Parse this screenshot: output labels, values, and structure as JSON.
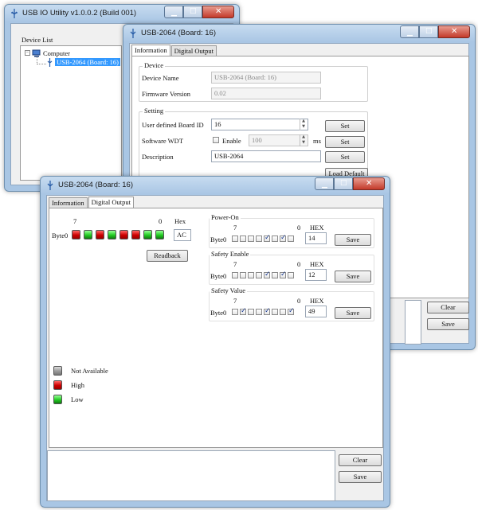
{
  "colors": {
    "led_high": "#dd0000",
    "led_low": "#22bb22",
    "led_na": "#999999",
    "selection": "#3399ff"
  },
  "main_window": {
    "title": "USB IO Utility    v1.0.0.2 (Build 001)",
    "device_list_label": "Device List",
    "tree_root": "Computer",
    "tree_child": "USB-2064 (Board: 16)"
  },
  "info_window": {
    "title": "USB-2064 (Board: 16)",
    "tabs": [
      "Information",
      "Digital Output"
    ],
    "device_group": "Device",
    "device_name_label": "Device Name",
    "device_name_value": "USB-2064 (Board: 16)",
    "firmware_label": "Firmware Version",
    "firmware_value": "0.02",
    "setting_group": "Setting",
    "board_id_label": "User defined Board ID",
    "board_id_value": "16",
    "wdt_label": "Software WDT",
    "wdt_enable_label": "Enable",
    "wdt_value": "100",
    "wdt_unit": "ms",
    "description_label": "Description",
    "description_value": "USB-2064",
    "set_label": "Set",
    "load_default_label": "Load Default",
    "clear_label": "Clear",
    "save_label": "Save"
  },
  "do_window": {
    "title": "USB-2064 (Board: 16)",
    "tabs": [
      "Information",
      "Digital Output"
    ],
    "bit_high_label": "7",
    "bit_low_label": "0",
    "hex_label": "Hex",
    "byte_label": "Byte0",
    "byte_leds": [
      "red",
      "green",
      "red",
      "green",
      "red",
      "red",
      "green",
      "green"
    ],
    "byte_hex": "AC",
    "readback_label": "Readback",
    "groups": [
      {
        "title": "Power-On",
        "checks": [
          false,
          false,
          false,
          false,
          true,
          false,
          true,
          false
        ],
        "hex": "14"
      },
      {
        "title": "Safety Enable",
        "checks": [
          false,
          false,
          false,
          false,
          true,
          false,
          true,
          false
        ],
        "hex": "12"
      },
      {
        "title": "Safety Value",
        "checks": [
          false,
          true,
          false,
          false,
          true,
          false,
          false,
          true
        ],
        "hex": "49"
      }
    ],
    "group_hex_label": "HEX",
    "save_label": "Save",
    "legend": [
      {
        "color": "gray",
        "label": "Not Available"
      },
      {
        "color": "red",
        "label": "High"
      },
      {
        "color": "green",
        "label": "Low"
      }
    ],
    "clear_label": "Clear"
  }
}
